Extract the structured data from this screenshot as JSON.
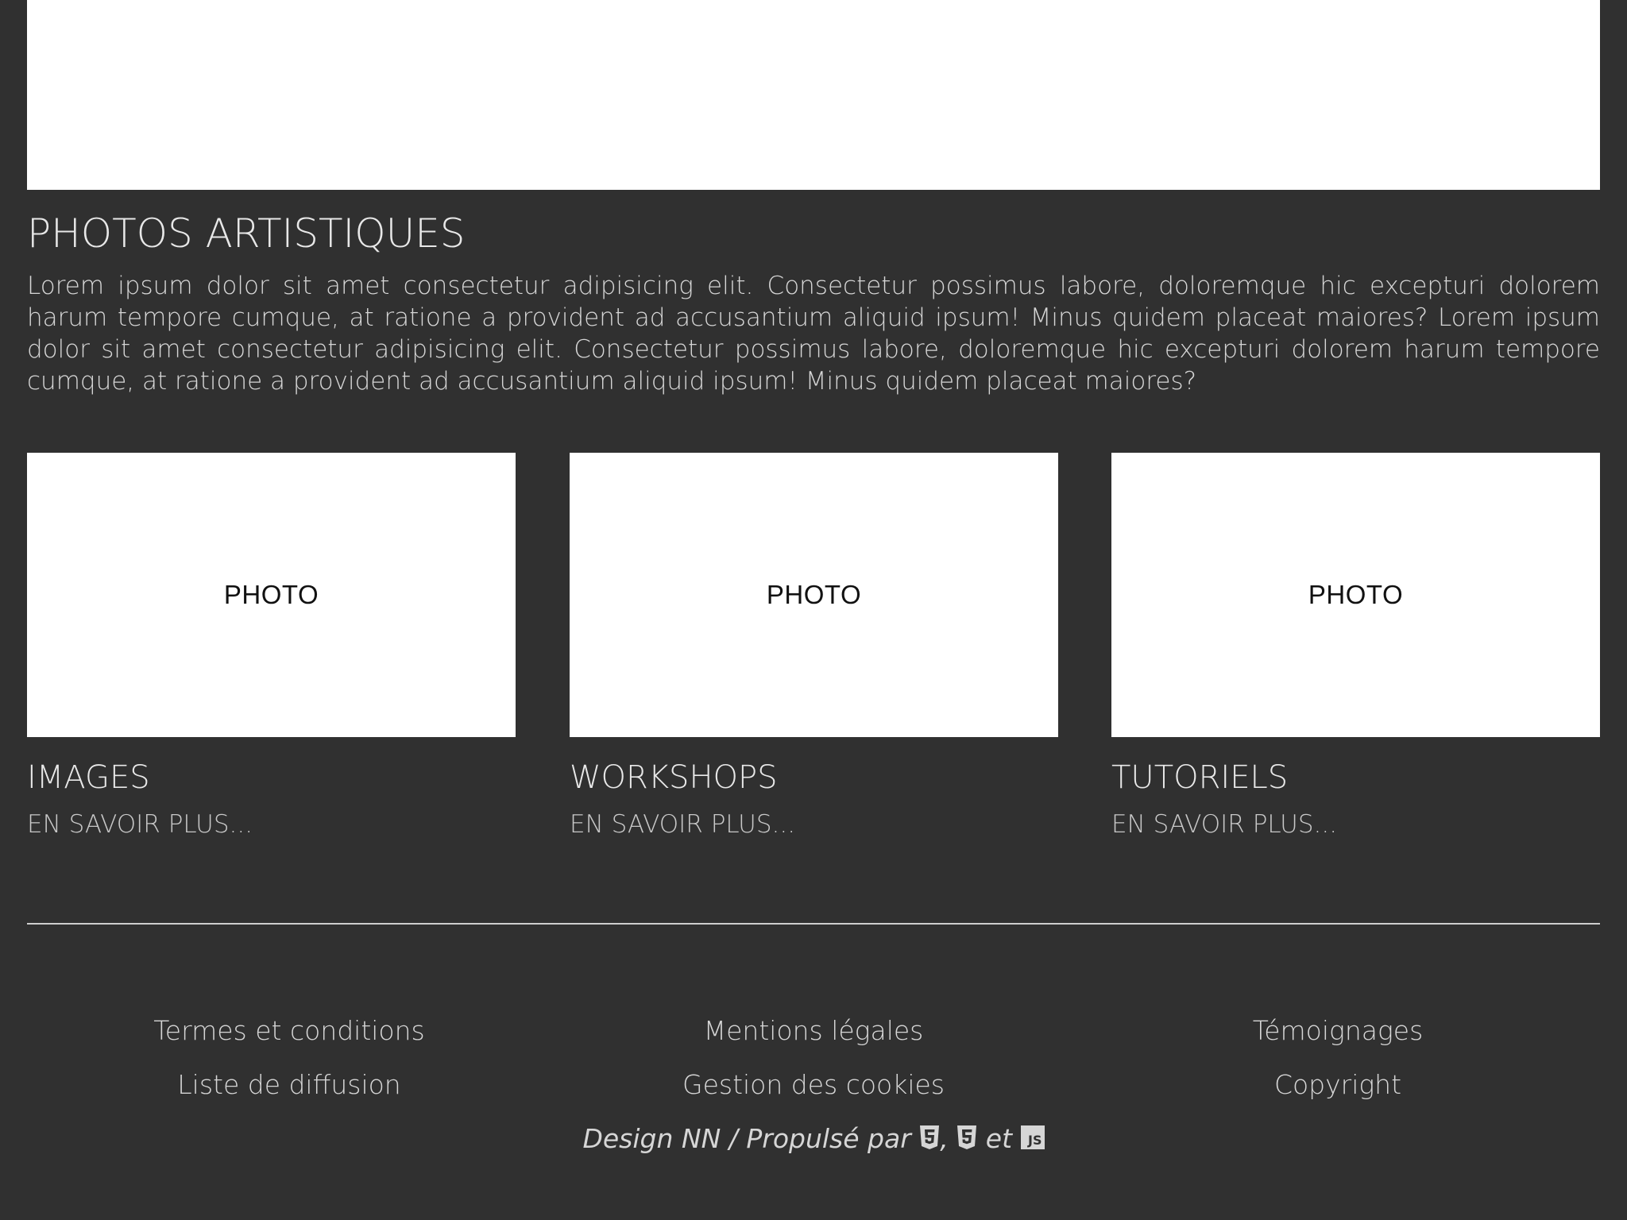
{
  "section": {
    "title": "PHOTOS ARTISTIQUES",
    "text": "Lorem ipsum dolor sit amet consectetur adipisicing elit. Consectetur possimus labore, doloremque hic excepturi dolorem harum tempore cumque, at ratione a provident ad accusantium aliquid ipsum! Minus quidem placeat maiores? Lorem ipsum dolor sit amet consectetur adipisicing elit. Consectetur possimus labore, doloremque hic excepturi dolorem harum tempore cumque, at ratione a provident ad accusantium aliquid ipsum! Minus quidem placeat maiores?"
  },
  "cards": [
    {
      "photo_label": "PHOTO",
      "title": "IMAGES",
      "link": "EN SAVOIR PLUS..."
    },
    {
      "photo_label": "PHOTO",
      "title": "WORKSHOPS",
      "link": "EN SAVOIR PLUS..."
    },
    {
      "photo_label": "PHOTO",
      "title": "TUTORIELS",
      "link": "EN SAVOIR PLUS..."
    }
  ],
  "footer": {
    "links": [
      "Termes et conditions",
      "Mentions légales",
      "Témoignages",
      "Liste de diffusion",
      "Gestion des cookies",
      "Copyright"
    ],
    "credits": {
      "prefix": "Design NN / Propulsé par",
      "separator": ",",
      "conjunction": "et",
      "icons": [
        "html5-icon",
        "css3-icon",
        "js-icon"
      ],
      "js_label": "JS"
    }
  },
  "colors": {
    "background": "#303030",
    "surface": "#ffffff",
    "text": "#e8e8e8"
  }
}
